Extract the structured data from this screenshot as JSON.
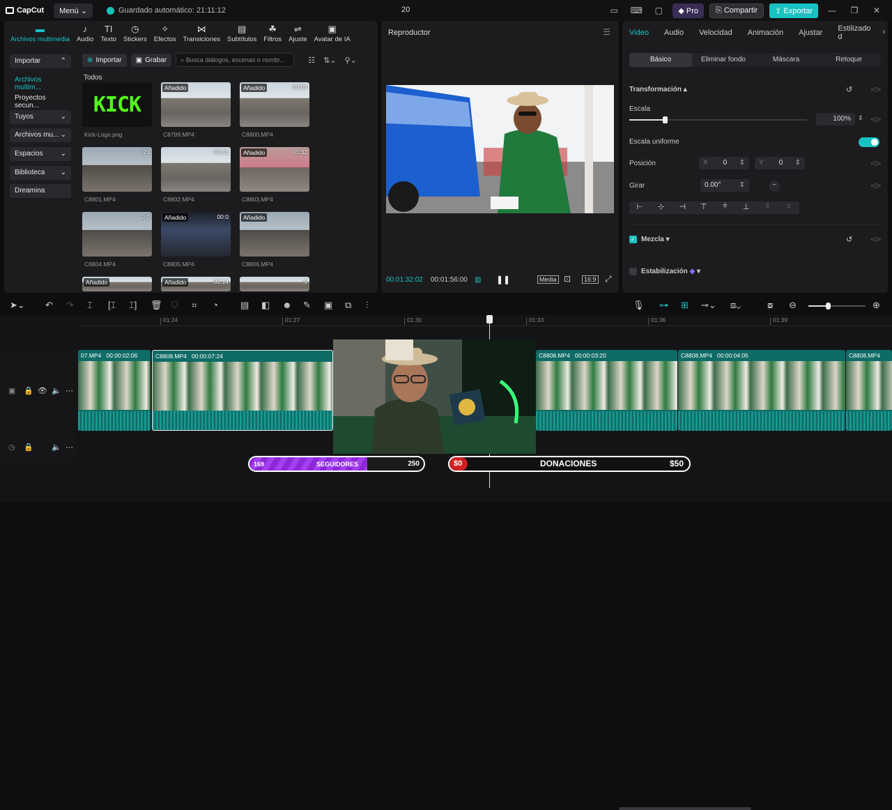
{
  "titlebar": {
    "app_name": "CapCut",
    "menu_label": "Menú",
    "autosave_text": "Guardado automático: 21:11:12",
    "project_name": "20",
    "pro_label": "Pro",
    "share_label": "Compartir",
    "export_label": "Exportar"
  },
  "media_tools": [
    {
      "label": "Archivos multimedia",
      "icon": "media-icon"
    },
    {
      "label": "Audio",
      "icon": "audio-icon"
    },
    {
      "label": "Texto",
      "icon": "text-icon"
    },
    {
      "label": "Stickers",
      "icon": "sticker-icon"
    },
    {
      "label": "Efectos",
      "icon": "effects-icon"
    },
    {
      "label": "Transiciones",
      "icon": "transition-icon"
    },
    {
      "label": "Subtítulos",
      "icon": "subtitles-icon"
    },
    {
      "label": "Filtros",
      "icon": "filter-icon"
    },
    {
      "label": "Ajuste",
      "icon": "adjust-icon"
    },
    {
      "label": "Avatar de IA",
      "icon": "avatar-icon"
    }
  ],
  "sidebar": [
    {
      "label": "Importar",
      "chevron": "⌃"
    },
    {
      "label": "Archivos multim...",
      "chevron": ""
    },
    {
      "label": "Proyectos secun...",
      "chevron": ""
    },
    {
      "label": "Tuyos",
      "chevron": "⌄"
    },
    {
      "label": "Archivos mu...",
      "chevron": "⌄"
    },
    {
      "label": "Espacios",
      "chevron": "⌄"
    },
    {
      "label": "Biblioteca",
      "chevron": "⌄"
    },
    {
      "label": "Dreamina",
      "chevron": ""
    }
  ],
  "media_toolbar": {
    "import_label": "Importar",
    "record_label": "Grabar",
    "search_placeholder": "Busca diálogos, escenas o nombr..."
  },
  "all_label": "Todos",
  "media_items": [
    {
      "name": "Kick-Logo.png",
      "tag": "",
      "duration": "",
      "logo_text": "KICK"
    },
    {
      "name": "C8799.MP4",
      "tag": "Añadido",
      "duration": ""
    },
    {
      "name": "C8800.MP4",
      "tag": "Añadido",
      "duration": "00:54"
    },
    {
      "name": "C8801.MP4",
      "tag": "",
      "duration": ":23"
    },
    {
      "name": "C8802.MP4",
      "tag": "",
      "duration": "00:11"
    },
    {
      "name": "C8803.MP4",
      "tag": "Añadido",
      "duration": "01:32"
    },
    {
      "name": "C8804.MP4",
      "tag": "",
      "duration": "0:0"
    },
    {
      "name": "C8805.MP4",
      "tag": "Añadido",
      "duration": "00:0"
    },
    {
      "name": "C8806.MP4",
      "tag": "Añadido",
      "duration": ""
    },
    {
      "name": "",
      "tag": "Añadido",
      "duration": ""
    },
    {
      "name": "",
      "tag": "Añadido",
      "duration": "02:14"
    },
    {
      "name": "",
      "tag": "",
      "duration": ":9"
    }
  ],
  "player": {
    "title": "Reproductor",
    "current_time": "00:01:32:02",
    "total_time": "00:01:56:00",
    "quality": "Media",
    "ratio": "16:9"
  },
  "inspector": {
    "tabs": [
      "Video",
      "Audio",
      "Velocidad",
      "Animación",
      "Ajustar",
      "Estilizado d"
    ],
    "subtabs": [
      "Básico",
      "Eliminar fondo",
      "Máscara",
      "Retoque"
    ],
    "transform_label": "Transformación",
    "scale_label": "Escala",
    "scale_value": "100%",
    "scale_fraction": 0.2,
    "uniform_label": "Escala uniforme",
    "position_label": "Posición",
    "pos_x_label": "X",
    "pos_x": "0",
    "pos_y_label": "Y",
    "pos_y": "0",
    "rotate_label": "Girar",
    "rotate_value": "0.00°",
    "blend_label": "Mezcla",
    "stabilize_label": "Estabilización"
  },
  "timeline": {
    "ruler_ticks": [
      "01:24",
      "01:27",
      "01:30",
      "01:33",
      "01:36",
      "01:39"
    ],
    "clips": [
      {
        "name": "07.MP4",
        "duration": "00:00:02:06"
      },
      {
        "name": "C8808.MP4",
        "duration": "00:00:07:24"
      },
      {
        "name": "C8808.MP4",
        "duration": "00:00:03:20"
      },
      {
        "name": "C8808.MP4",
        "duration": "00:00:04:05"
      },
      {
        "name": "C8808.MP4",
        "duration": ""
      }
    ]
  },
  "overlay_bars": {
    "followers_current": "169",
    "followers_label": "SEGUIDORES",
    "followers_goal": "250",
    "followers_fraction": 0.676,
    "donations_current": "$0",
    "donations_label": "DONACIONES",
    "donations_goal": "$50"
  },
  "colors": {
    "accent": "#19c2c2",
    "clip": "#0f6b66",
    "purple": "#8d27d8",
    "red": "#d11f1f"
  }
}
